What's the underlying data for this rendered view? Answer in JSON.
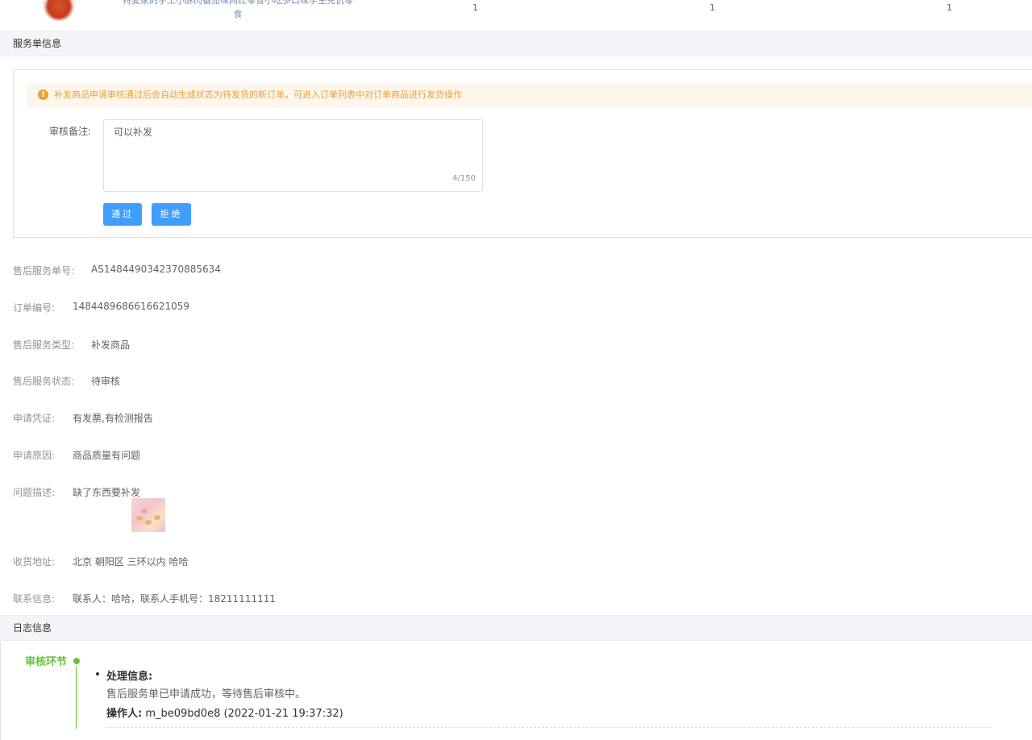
{
  "product": {
    "name_line1": "特麦家的手工小酥肉番茄味网红零食小吃多口味学生充饥零",
    "name_line2": "食",
    "qty1": "1",
    "qty2": "1",
    "qty3": "1"
  },
  "service_section": {
    "title": "服务单信息",
    "alert_text": "补发商品申请审核通过后会自动生成状态为待发货的新订单，可进入订单列表中对订单商品进行发货操作",
    "remark_label": "审核备注:",
    "remark_value": "可以补发",
    "remark_count": "4/150",
    "approve_label": "通过",
    "reject_label": "拒绝"
  },
  "details": {
    "service_no_label": "售后服务单号:",
    "service_no": "AS1484490342370885634",
    "order_no_label": "订单编号:",
    "order_no": "1484489686616621059",
    "service_type_label": "售后服务类型:",
    "service_type": "补发商品",
    "service_status_label": "售后服务状态:",
    "service_status": "待审核",
    "proof_label": "申请凭证:",
    "proof": "有发票,有检测报告",
    "reason_label": "申请原因:",
    "reason": "商品质量有问题",
    "description_label": "问题描述:",
    "description": "缺了东西要补发",
    "address_label": "收货地址:",
    "address": "北京 朝阳区 三环以内 哈哈",
    "contact_label": "联系信息:",
    "contact": "联系人：哈哈，联系人手机号：18211111111"
  },
  "log_section": {
    "title": "日志信息",
    "stage": "审核环节",
    "entry_title": "处理信息:",
    "entry_message": "售后服务单已申请成功，等待售后审核中。",
    "operator_label": "操作人:",
    "operator_value": "m_be09bd0e8 (2022-01-21 19:37:32)"
  },
  "colors": {
    "primary": "#409eff",
    "success": "#67c23a",
    "warning": "#e6a23c"
  }
}
